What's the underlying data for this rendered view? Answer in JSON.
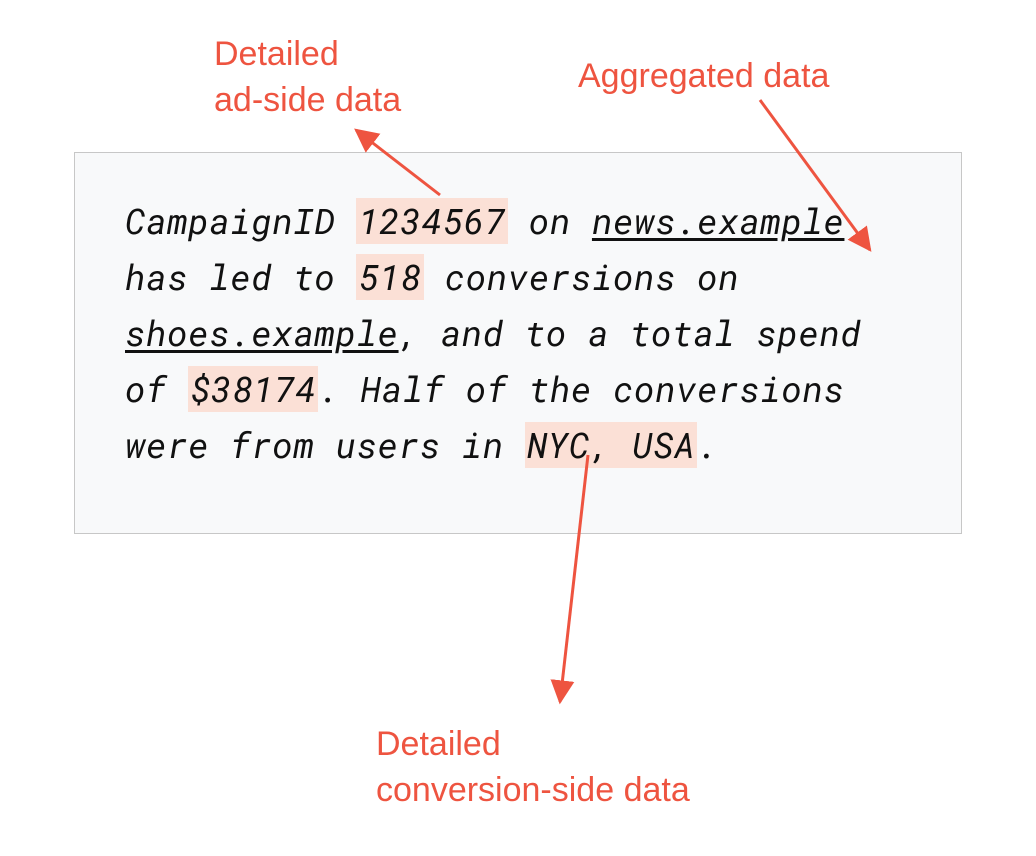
{
  "labels": {
    "adside": "Detailed\nad-side data",
    "aggregated": "Aggregated data",
    "conversionside": "Detailed\nconversion-side data"
  },
  "content": {
    "t1": "CampaignID ",
    "campaign_id": "1234567",
    "t2": " on ",
    "site1": "news.example",
    "t3": " has led to ",
    "conversions": "518",
    "t4": " conversions on ",
    "site2": "shoes.example",
    "t5": ", and to a total spend of ",
    "spend": "$38174",
    "t6": ". Half of the conversions were from users in ",
    "location": "NYC, USA",
    "t7": "."
  },
  "colors": {
    "accent": "#ee5440",
    "highlight": "#fbe0d6",
    "box_bg": "#f8f9fa",
    "box_border": "#c7c7c7"
  }
}
